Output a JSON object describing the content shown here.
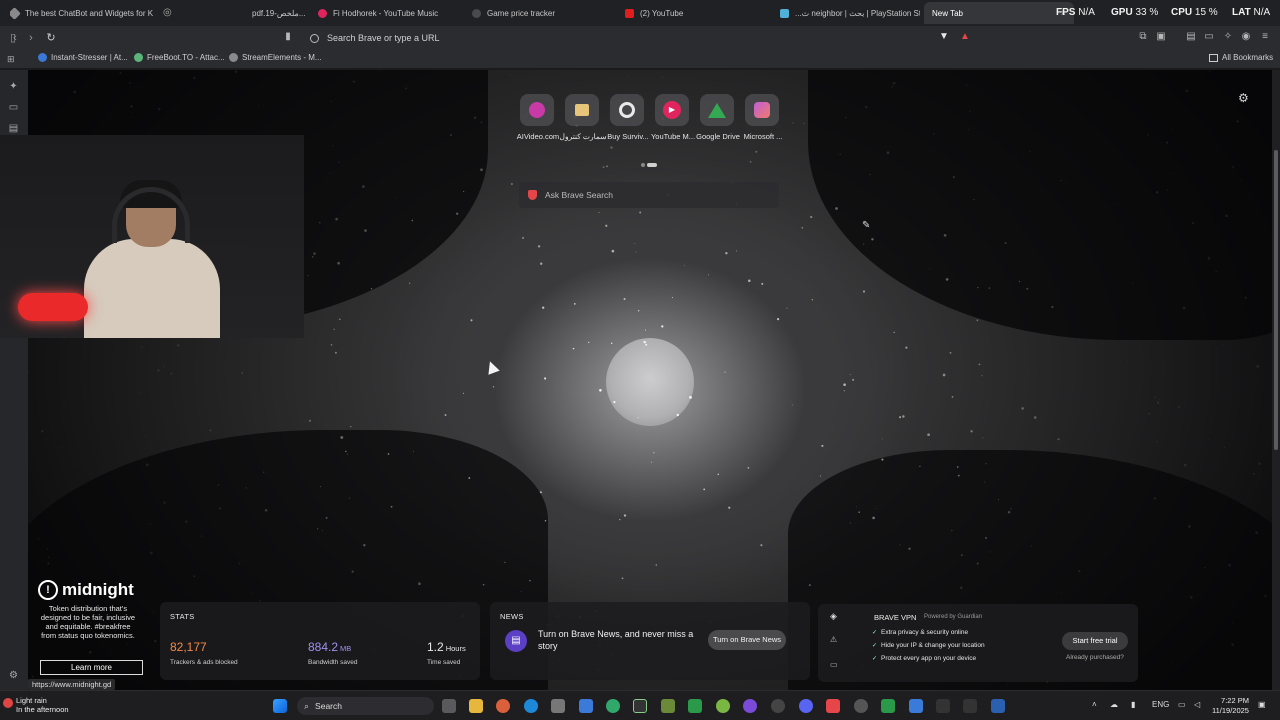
{
  "tabs": [
    {
      "title": "The best ChatBot and Widgets for K",
      "color": "#8a8a8d"
    },
    {
      "title": "pdf.ملخص-19...",
      "color": "#8a8a8d"
    },
    {
      "title": "Fi Hodhorek - YouTube Music",
      "color": "#e0245e"
    },
    {
      "title": "Game price tracker",
      "color": "#6b6b6e"
    },
    {
      "title": "(2) YouTube",
      "color": "#e01e1e"
    },
    {
      "title": "...ث neighbor | بحث | PlayStation Store",
      "color": "#4fb1d8"
    },
    {
      "title": "New Tab",
      "color": "#35363a"
    }
  ],
  "perf": {
    "fps_label": "FPS",
    "fps": "N/A",
    "gpu_label": "GPU",
    "gpu": "33 %",
    "cpu_label": "CPU",
    "cpu": "15 %",
    "lat_label": "LAT",
    "lat": "N/A"
  },
  "omnibox": {
    "placeholder": "Search Brave or type a URL"
  },
  "bookmarks": [
    {
      "label": "Instant-Stresser | At...",
      "color": "#3a77d6"
    },
    {
      "label": "FreeBoot.TO - Attac...",
      "color": "#5bb57a"
    },
    {
      "label": "StreamElements - M...",
      "color": "#8a8a8d"
    }
  ],
  "all_bookmarks": "All Bookmarks",
  "top_sites": [
    {
      "label": "AIVideo.com",
      "icon": "ai-video-icon",
      "color": "#c83aa6"
    },
    {
      "label": "سمارت كنترول",
      "icon": "smart-control-icon",
      "color": "#e6c47a"
    },
    {
      "label": "Buy Surviv...",
      "icon": "target-icon",
      "color": "#e9e9e9"
    },
    {
      "label": "YouTube M...",
      "icon": "youtube-music-icon",
      "color": "#e0245e"
    },
    {
      "label": "Google Drive",
      "icon": "google-drive-icon",
      "color": "#34a853"
    },
    {
      "label": "Microsoft ...",
      "icon": "microsoft-icon",
      "color": "#c05fd6"
    }
  ],
  "ask_search": {
    "placeholder": "Ask Brave Search"
  },
  "midnight": {
    "name": "midnight",
    "desc": "Token distribution that's designed to be fair, inclusive and equitable. #breakfree from status quo tokenomics.",
    "cta": "Learn more",
    "status_url": "https://www.midnight.gd"
  },
  "stats": {
    "title": "STATS",
    "trackers": "82,177",
    "trackers_label": "Trackers & ads blocked",
    "bandwidth": "884.2",
    "bandwidth_unit": "MB",
    "bandwidth_label": "Bandwidth saved",
    "time": "1.2",
    "time_unit": "Hours",
    "time_label": "Time saved",
    "trackers_color": "#f08a4a",
    "bandwidth_color": "#a08ff0"
  },
  "news": {
    "title": "NEWS",
    "text": "Turn on Brave News, and never miss a story",
    "button": "Turn on Brave News"
  },
  "vpn": {
    "title": "BRAVE VPN",
    "powered": "Powered by",
    "partner": "Guardian",
    "items": [
      "Extra privacy & security online",
      "Hide your IP & change your location",
      "Protect every app on your device"
    ],
    "button": "Start free trial",
    "purchased": "Already purchased?"
  },
  "taskbar": {
    "weather_text": "Light rain",
    "weather_sub": "In the afternoon",
    "search": "Search",
    "lang": "ENG",
    "time": "7:22 PM",
    "date": "11/19/2025"
  }
}
